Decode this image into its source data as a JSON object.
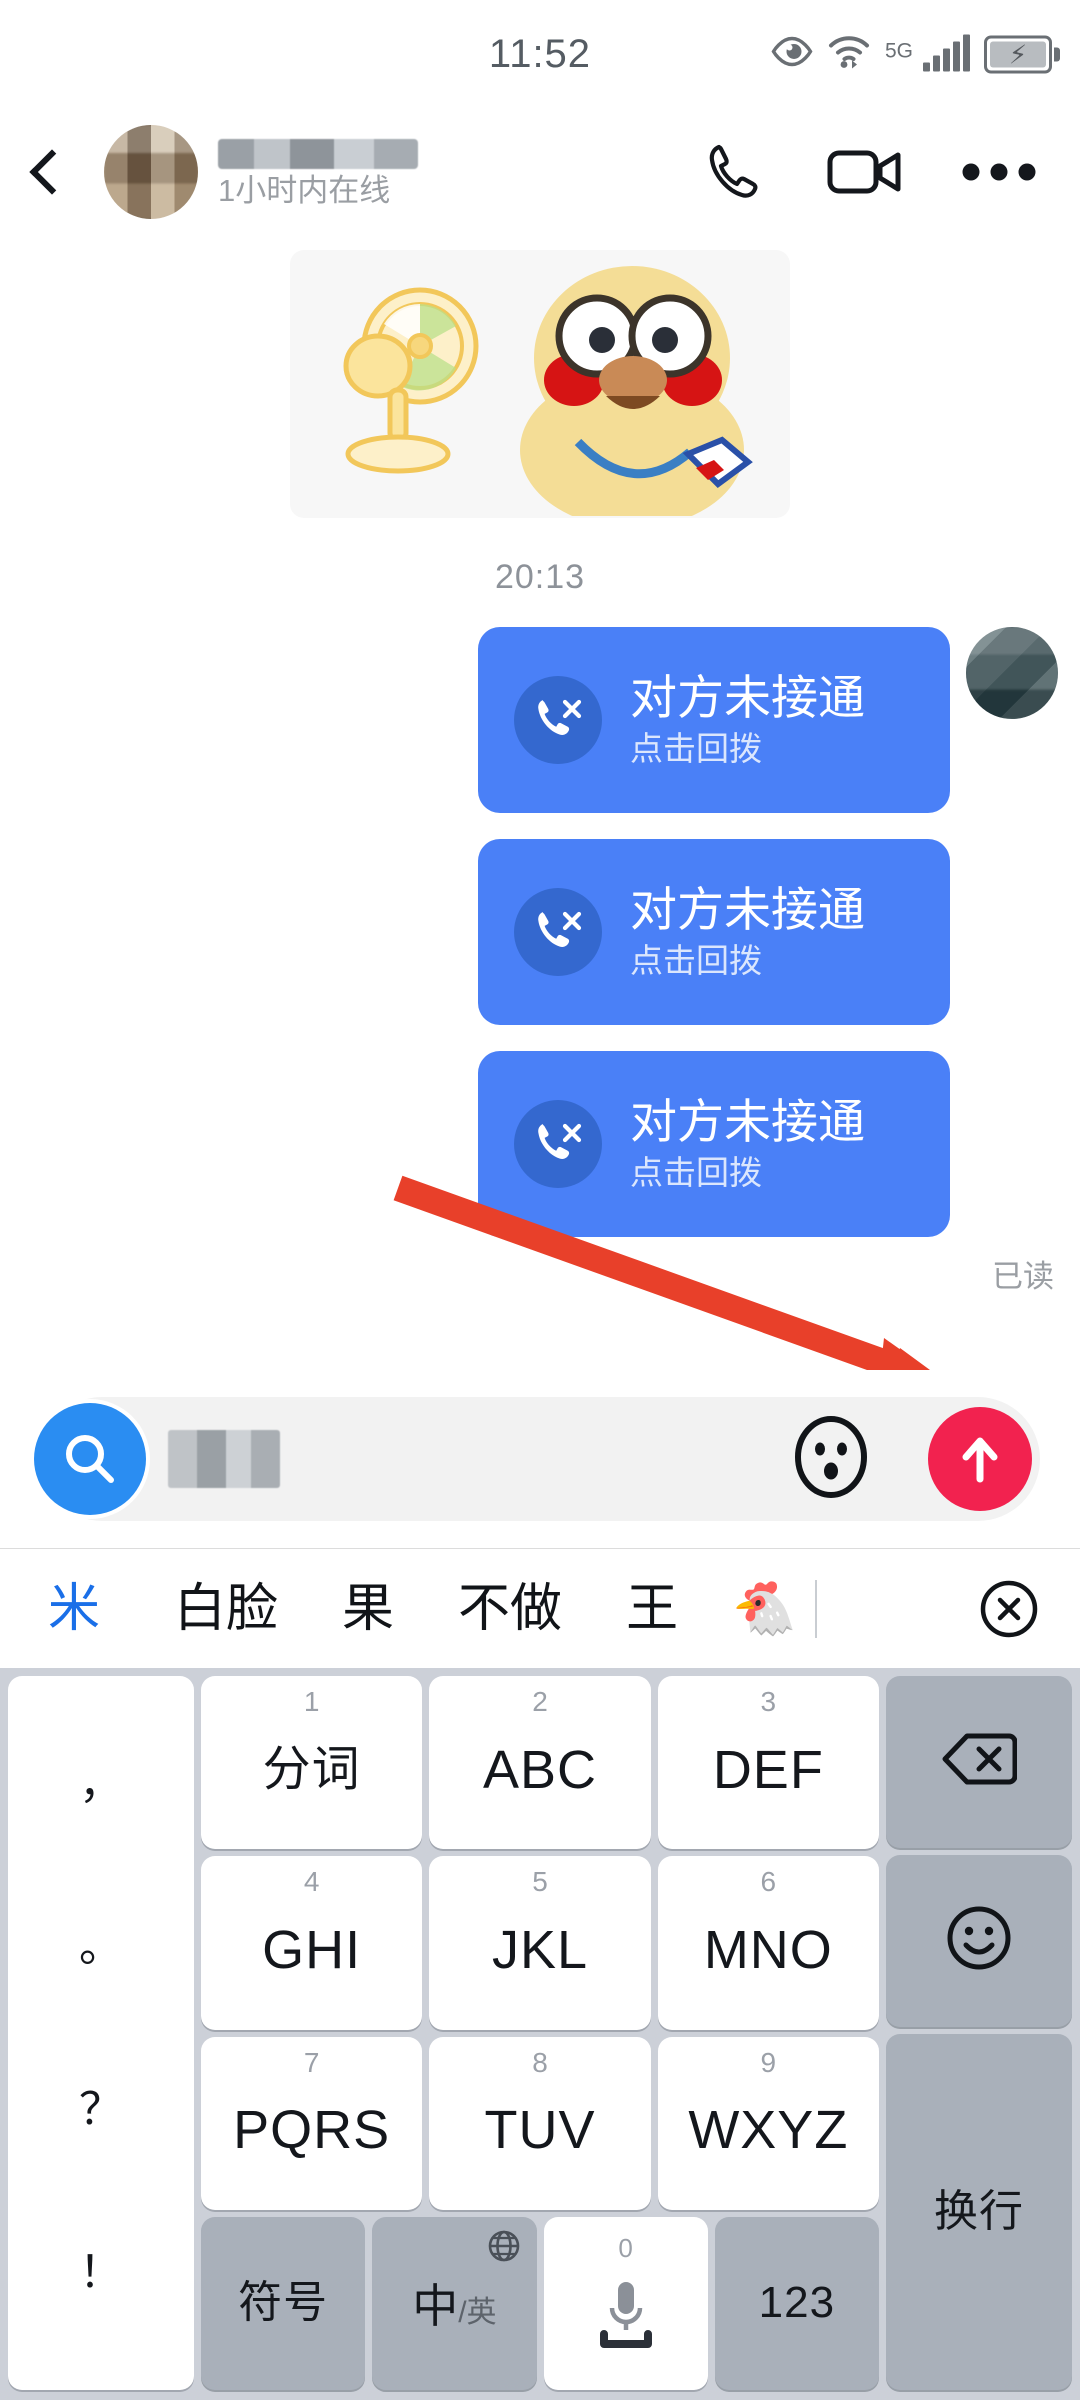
{
  "status_bar": {
    "clock": "11:52",
    "network_label": "5G",
    "icons": [
      "eye-care-icon",
      "wifi-icon",
      "signal-bars-icon",
      "battery-charging-icon"
    ]
  },
  "header": {
    "back_icon": "back-chevron-icon",
    "contact_name": "",
    "online_status": "1小时内在线",
    "actions": [
      "voice-call-icon",
      "video-call-icon",
      "more-options-icon"
    ]
  },
  "conversation": {
    "sticker_alt": "黄色小鸡与电风扇表情包",
    "time_separator": "20:13",
    "messages": [
      {
        "title": "对方未接通",
        "subtitle": "点击回拨",
        "icon": "missed-call-icon"
      },
      {
        "title": "对方未接通",
        "subtitle": "点击回拨",
        "icon": "missed-call-icon"
      },
      {
        "title": "对方未接通",
        "subtitle": "点击回拨",
        "icon": "missed-call-icon"
      }
    ],
    "read_receipt": "已读"
  },
  "annotation": {
    "type": "red-arrow",
    "color": "#e8402a",
    "points_to": "已读"
  },
  "input_bar": {
    "search_icon": "search-icon",
    "typed_text": "",
    "emoji_icon": "emoji-face-icon",
    "send_icon": "send-arrow-up-icon",
    "send_color": "#f2224f",
    "search_color": "#2a8df2"
  },
  "candidates": {
    "items": [
      "米",
      "白脸",
      "果",
      "不做",
      "王"
    ],
    "emoji": "🐔",
    "selected_index": 0,
    "close_icon": "close-circle-icon"
  },
  "keyboard": {
    "punctuation": [
      "，",
      "。",
      "？",
      "！"
    ],
    "rows": [
      [
        {
          "num": "1",
          "label": "分词",
          "cn": true
        },
        {
          "num": "2",
          "label": "ABC",
          "cn": false
        },
        {
          "num": "3",
          "label": "DEF",
          "cn": false
        }
      ],
      [
        {
          "num": "4",
          "label": "GHI",
          "cn": false
        },
        {
          "num": "5",
          "label": "JKL",
          "cn": false
        },
        {
          "num": "6",
          "label": "MNO",
          "cn": false
        }
      ],
      [
        {
          "num": "7",
          "label": "PQRS",
          "cn": false
        },
        {
          "num": "8",
          "label": "TUV",
          "cn": false
        },
        {
          "num": "9",
          "label": "WXYZ",
          "cn": false
        }
      ]
    ],
    "bottom_row": {
      "symbols": "符号",
      "lang_primary": "中",
      "lang_secondary": "/英",
      "globe_icon": "globe-icon",
      "space_zero": "0",
      "space_icon": "microphone-icon",
      "numeric": "123"
    },
    "side_keys": {
      "backspace": "backspace-icon",
      "emoji": "emoji-smiley-icon",
      "enter": "换行"
    }
  }
}
